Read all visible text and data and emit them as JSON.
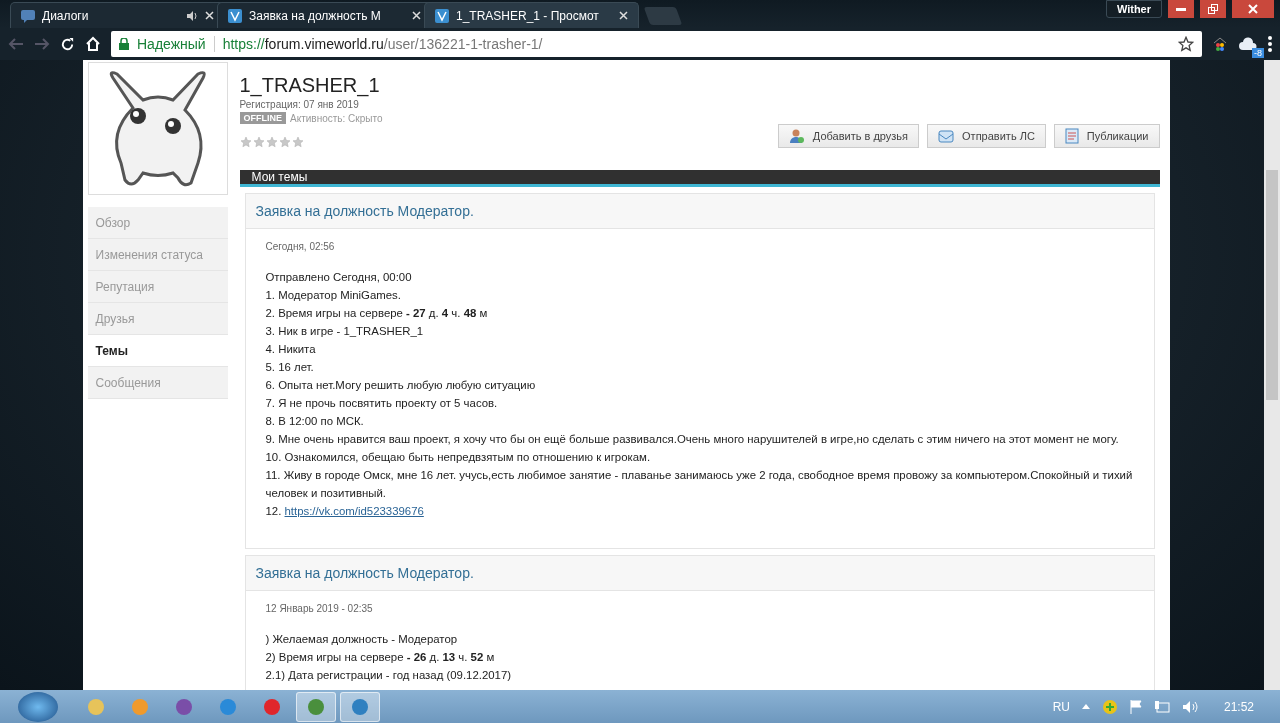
{
  "browser": {
    "tabs": [
      {
        "title": "Диалоги",
        "kind": "chat",
        "audio": true,
        "selected": false
      },
      {
        "title": "Заявка на должность М",
        "kind": "site",
        "audio": false,
        "selected": false
      },
      {
        "title": "1_TRASHER_1 - Просмот",
        "kind": "site",
        "audio": false,
        "selected": true
      }
    ],
    "user_badge": "Wither",
    "secure_label": "Надежный",
    "url_scheme": "https://",
    "url_host": "forum.vimeworld.ru",
    "url_path": "/user/136221-1-trasher-1/",
    "extension_badge": "-8"
  },
  "profile": {
    "name": "1_TRASHER_1",
    "registered": "Регистрация: 07 янв 2019",
    "status": "OFFLINE",
    "activity": "Активность: Скрыто",
    "stars": 0,
    "buttons": [
      {
        "label": "Добавить в друзья",
        "kind": "friend"
      },
      {
        "label": "Отправить ЛС",
        "kind": "mail"
      },
      {
        "label": "Публикации",
        "kind": "doc"
      }
    ]
  },
  "sidebar": {
    "items": [
      {
        "label": "Обзор",
        "selected": false
      },
      {
        "label": "Изменения статуса",
        "selected": false
      },
      {
        "label": "Репутация",
        "selected": false
      },
      {
        "label": "Друзья",
        "selected": false
      },
      {
        "label": "Темы",
        "selected": true
      },
      {
        "label": "Сообщения",
        "selected": false
      }
    ]
  },
  "section_title": "Мои темы",
  "posts": [
    {
      "title": "Заявка на должность Модератор.",
      "date": "Сегодня, 02:56",
      "lines": [
        {
          "kind": "text",
          "text": "Отправлено Сегодня, 00:00"
        },
        {
          "kind": "text",
          "text": "1. Модератор MiniGames."
        },
        {
          "kind": "text",
          "text": "2. Время игры на сервере **- 27** д. **4** ч. **48** м"
        },
        {
          "kind": "text",
          "text": "3. Ник в игре - 1_TRASHER_1"
        },
        {
          "kind": "text",
          "text": "4. Никита"
        },
        {
          "kind": "text",
          "text": "5. 16 лет."
        },
        {
          "kind": "text",
          "text": "6. Опыта нет.Могу решить любую любую ситуацию"
        },
        {
          "kind": "text",
          "text": "7. Я не прочь посвятить проекту от 5 часов."
        },
        {
          "kind": "text",
          "text": "8. В 12:00 по МСК."
        },
        {
          "kind": "text",
          "text": "9. Мне очень нравится ваш проект, я хочу что бы он ещё больше развивался.Очень много нарушителей в игре,но сделать с этим ничего на этот  момент не могу."
        },
        {
          "kind": "text",
          "text": "10. Ознакомился, обещаю быть непредвзятым по отношению к игрокам."
        },
        {
          "kind": "text",
          "text": "11. Живу в городе Омск, мне 16 лет. учусь,есть любимое занятие - плаванье занимаюсь уже 2 года, свободное время провожу за компьютером.Спокойный и тихий человек и позитивный."
        },
        {
          "kind": "link",
          "prefix": "12.",
          "text": "https://vk.com/id523339676"
        }
      ]
    },
    {
      "title": "Заявка на должность Модератор.",
      "date": "12 Январь 2019 - 02:35",
      "lines": [
        {
          "kind": "text",
          "text": ") Желаемая должность - Модератор"
        },
        {
          "kind": "text",
          "text": "2) Время игры на сервере **- 26** д. **13** ч. **52** м"
        },
        {
          "kind": "text",
          "text": "2.1) Дата регистрации - год назад (09.12.2017)"
        }
      ]
    }
  ],
  "taskbar": {
    "apps": [
      {
        "kind": "folder",
        "selected": false
      },
      {
        "kind": "player",
        "selected": false
      },
      {
        "kind": "studio",
        "selected": false
      },
      {
        "kind": "ie",
        "selected": false
      },
      {
        "kind": "opera",
        "selected": false
      },
      {
        "kind": "chrome",
        "selected": true
      },
      {
        "kind": "vime",
        "selected": true
      }
    ],
    "language": "RU",
    "time": "21:52"
  }
}
